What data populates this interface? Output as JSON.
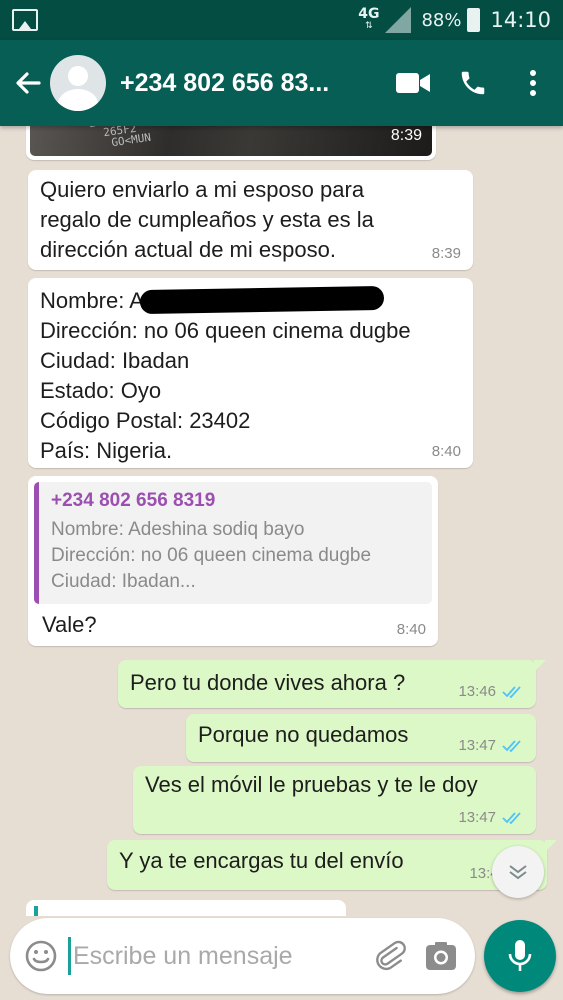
{
  "status_bar": {
    "network": "4G",
    "battery_percent": "88%",
    "time": "14:10"
  },
  "header": {
    "contact_name": "+234 802 656 83..."
  },
  "messages": [
    {
      "direction": "in",
      "type": "image",
      "time": "8:39"
    },
    {
      "direction": "in",
      "text": "Quiero enviarlo a mi esposo para\nregalo de cumpleaños y esta es la\ndirección actual de mi esposo.",
      "time": "8:39"
    },
    {
      "direction": "in",
      "name_label": "Nombre: A",
      "lines": [
        "Dirección: no 06 queen cinema dugbe",
        "Ciudad: Ibadan",
        "Estado: Oyo",
        "Código Postal: 23402",
        "País: Nigeria."
      ],
      "time": "8:40"
    },
    {
      "direction": "in",
      "quoted": {
        "title": "+234 802 656 8319",
        "lines": [
          "Nombre: Adeshina sodiq bayo",
          "Dirección: no 06 queen cinema dugbe",
          "Ciudad: Ibadan..."
        ]
      },
      "text": "Vale?",
      "time": "8:40"
    },
    {
      "direction": "out",
      "text": "Pero tu donde vives ahora ?",
      "time": "13:46",
      "status": "read"
    },
    {
      "direction": "out",
      "text": "Porque no quedamos",
      "time": "13:47",
      "status": "read"
    },
    {
      "direction": "out",
      "text": "Ves el móvil le pruebas y te le doy",
      "time": "13:47",
      "status": "read"
    },
    {
      "direction": "out",
      "text": "Y ya te encargas tu del envío",
      "time": "13:47",
      "status": "read"
    }
  ],
  "composer": {
    "placeholder": "Escribe un mensaje"
  },
  "colors": {
    "status_bar": "#044d43",
    "header": "#075e54",
    "outgoing_bubble": "#dcf8c6",
    "incoming_bubble": "#ffffff",
    "read_ticks": "#4fc3f7",
    "quote_accent": "#9b4fb0",
    "mic_button": "#00897b"
  }
}
